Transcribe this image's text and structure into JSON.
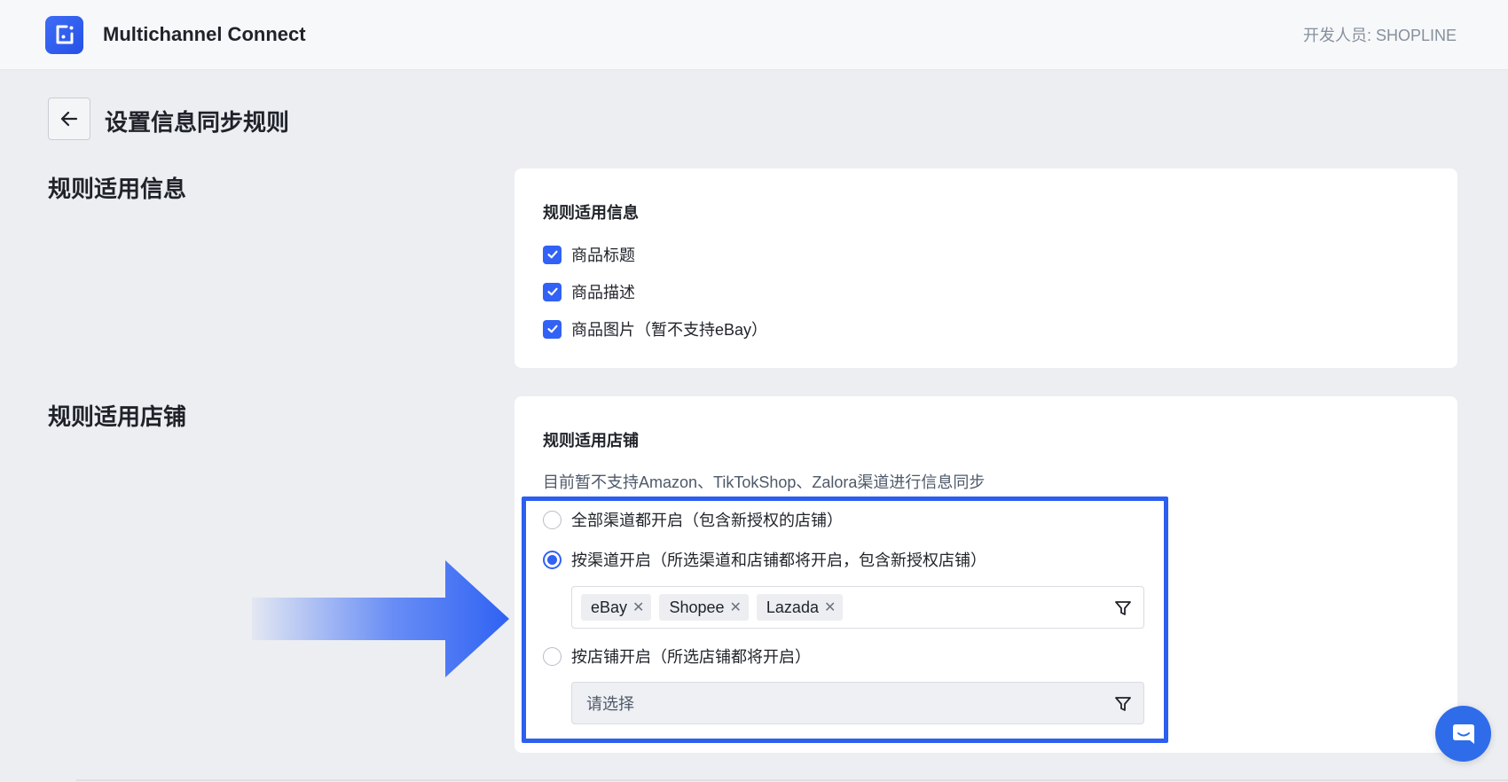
{
  "header": {
    "app_name": "Multichannel Connect",
    "developer": "开发人员: SHOPLINE"
  },
  "page_title": "设置信息同步规则",
  "section_info": {
    "label": "规则适用信息",
    "card_title": "规则适用信息",
    "options": [
      {
        "label": "商品标题",
        "checked": true
      },
      {
        "label": "商品描述",
        "checked": true
      },
      {
        "label": "商品图片（暂不支持eBay）",
        "checked": true
      }
    ]
  },
  "section_store": {
    "label": "规则适用店铺",
    "card_title": "规则适用店铺",
    "hint": "目前暂不支持Amazon、TikTokShop、Zalora渠道进行信息同步",
    "radios": [
      {
        "label": "全部渠道都开启（包含新授权的店铺）",
        "checked": false
      },
      {
        "label": "按渠道开启（所选渠道和店铺都将开启，包含新授权店铺）",
        "checked": true
      },
      {
        "label": "按店铺开启（所选店铺都将开启）",
        "checked": false
      }
    ],
    "channel_tags": [
      "eBay",
      "Shopee",
      "Lazada"
    ],
    "store_placeholder": "请选择"
  },
  "colors": {
    "accent": "#3161f5",
    "highlight": "#2c5ff0",
    "background": "#eceef2"
  },
  "icons": {
    "logo": "app-logo-icon",
    "back": "arrow-left-icon",
    "filter": "filter-icon",
    "chat": "chat-icon",
    "annotation": "big-arrow-right-icon"
  }
}
